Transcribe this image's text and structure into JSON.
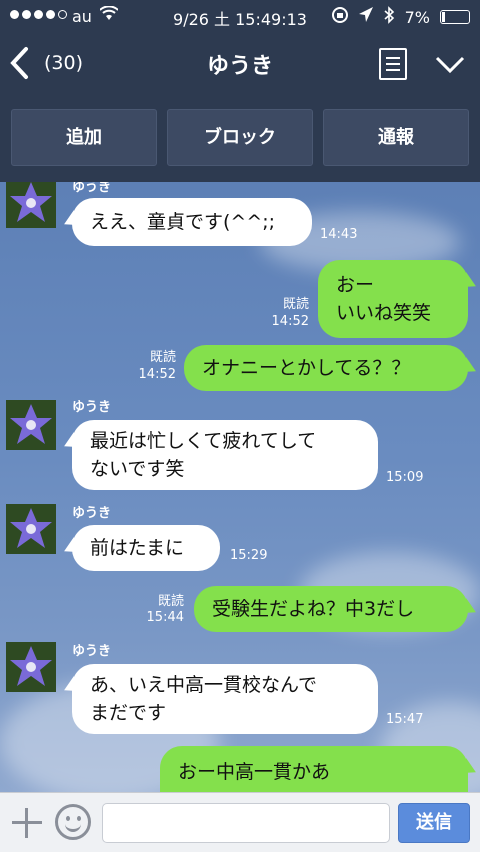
{
  "status": {
    "carrier": "au",
    "time": "9/26 土 15:49:13",
    "battery": "7%"
  },
  "nav": {
    "unread_count": "(30)",
    "title": "ゆうき"
  },
  "actions": {
    "add_label": "追加",
    "block_label": "ブロック",
    "report_label": "通報"
  },
  "messages": [
    {
      "direction": "in",
      "sender": "ゆうき",
      "lines": [
        "ええ、童貞です(^^;;"
      ],
      "time": "14:43"
    },
    {
      "direction": "out",
      "read": "既読",
      "lines": [
        "おー",
        "いいね笑笑"
      ],
      "time": "14:52"
    },
    {
      "direction": "out",
      "read": "既読",
      "lines": [
        "オナニーとかしてる？？"
      ],
      "time": "14:52"
    },
    {
      "direction": "in",
      "sender": "ゆうき",
      "lines": [
        "最近は忙しくて疲れてして",
        "ないです笑"
      ],
      "time": "15:09"
    },
    {
      "direction": "in",
      "sender": "ゆうき",
      "lines": [
        "前はたまに"
      ],
      "time": "15:29"
    },
    {
      "direction": "out",
      "read": "既読",
      "lines": [
        "受験生だよね？中3だし"
      ],
      "time": "15:44"
    },
    {
      "direction": "in",
      "sender": "ゆうき",
      "lines": [
        "あ、いえ中高一貫校なんで",
        "まだです"
      ],
      "time": "15:47"
    },
    {
      "direction": "out",
      "lines": [
        "おー中高一貫かあ"
      ]
    }
  ],
  "input": {
    "placeholder": "",
    "send_label": "送信"
  },
  "colors": {
    "header_bg": "#2d3a50",
    "outgoing_bubble": "#84e04c",
    "incoming_bubble": "#ffffff",
    "send_button": "#5b8cdc"
  },
  "icons": [
    "back-chevron-icon",
    "notes-icon",
    "chevron-down-icon",
    "plus-icon",
    "emoji-icon",
    "wifi-icon",
    "location-icon",
    "bluetooth-icon",
    "battery-icon"
  ]
}
